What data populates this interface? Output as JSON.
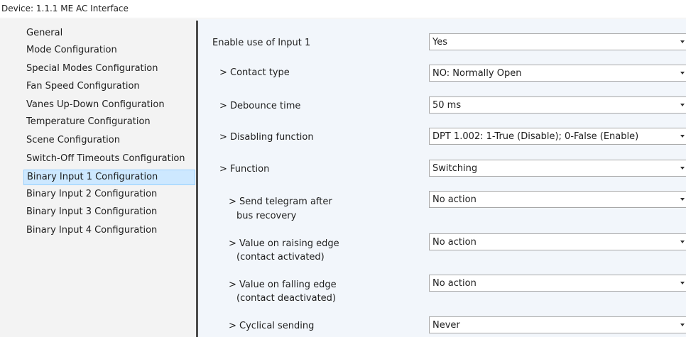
{
  "window": {
    "title": "Device: 1.1.1  ME AC Interface"
  },
  "sidebar": {
    "items": [
      {
        "label": "General"
      },
      {
        "label": "Mode Configuration"
      },
      {
        "label": "Special Modes Configuration"
      },
      {
        "label": "Fan Speed Configuration"
      },
      {
        "label": "Vanes Up-Down Configuration"
      },
      {
        "label": "Temperature Configuration"
      },
      {
        "label": "Scene Configuration"
      },
      {
        "label": "Switch-Off Timeouts Configuration"
      },
      {
        "label": "Binary Input 1 Configuration",
        "selected": true
      },
      {
        "label": "Binary Input 2 Configuration"
      },
      {
        "label": "Binary Input 3 Configuration"
      },
      {
        "label": "Binary Input 4 Configuration"
      }
    ]
  },
  "params": [
    {
      "label": "Enable use of Input 1",
      "value": "Yes"
    },
    {
      "label": "> Contact type",
      "value": "NO: Normally Open"
    },
    {
      "label": "> Debounce time",
      "value": "50 ms"
    },
    {
      "label": "> Disabling function",
      "value": "DPT 1.002: 1-True (Disable); 0-False (Enable)"
    },
    {
      "label": "> Function",
      "value": "Switching"
    },
    {
      "label_line1": "> Send telegram after",
      "label_line2": "bus recovery",
      "value": "No action"
    },
    {
      "label_line1": "> Value on raising edge",
      "label_line2": "(contact activated)",
      "value": "No action"
    },
    {
      "label_line1": "> Value on falling edge",
      "label_line2": "(contact deactivated)",
      "value": "No action"
    },
    {
      "label": "> Cyclical sending",
      "value": "Never"
    }
  ],
  "colors": {
    "selected_bg": "#cde8ff",
    "selected_border": "#99d1ff",
    "panel_bg": "#f2f6fb",
    "sidebar_bg": "#f3f3f3"
  },
  "icons": {
    "dropdown": "chevron-down-icon"
  }
}
